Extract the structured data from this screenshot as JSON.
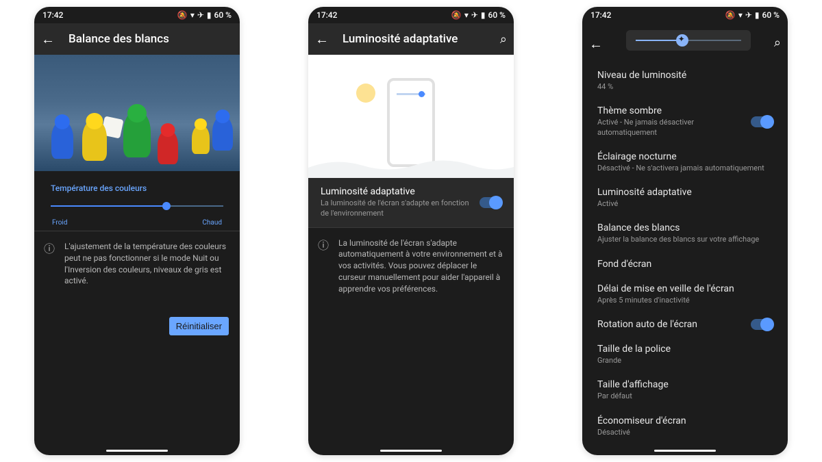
{
  "status": {
    "time": "17:42",
    "battery": "60 %"
  },
  "screen1": {
    "title": "Balance des blancs",
    "section_label": "Température des couleurs",
    "cold": "Froid",
    "hot": "Chaud",
    "slider_pct": 67,
    "info": "L'ajustement de la température des couleurs peut ne pas fonctionner si le mode Nuit ou l'Inversion des couleurs, niveaux de gris est activé.",
    "reset": "Réinitialiser"
  },
  "screen2": {
    "title": "Luminosité adaptative",
    "setting_title": "Luminosité adaptative",
    "setting_sub": "La luminosité de l'écran s'adapte en fonction de l'environnement",
    "info": "La luminosité de l'écran s'adapte automatiquement à votre environnement et à vos activités. Vous pouvez déplacer le curseur manuellement pour aider l'appareil à apprendre vos préférences."
  },
  "screen3": {
    "brightness_pct": 44,
    "items": [
      {
        "title": "Niveau de luminosité",
        "sub": "44 %",
        "toggle": null
      },
      {
        "title": "Thème sombre",
        "sub": "Activé - Ne jamais désactiver automatiquement",
        "toggle": true
      },
      {
        "title": "Éclairage nocturne",
        "sub": "Désactivé - Ne s'activera jamais automatiquement",
        "toggle": null
      },
      {
        "title": "Luminosité adaptative",
        "sub": "Activé",
        "toggle": null
      },
      {
        "title": "Balance des blancs",
        "sub": "Ajuster la balance des blancs sur votre affichage",
        "toggle": null
      },
      {
        "title": "Fond d'écran",
        "sub": "",
        "toggle": null
      },
      {
        "title": "Délai de mise en veille de l'écran",
        "sub": "Après 5 minutes d'inactivité",
        "toggle": null
      },
      {
        "title": "Rotation auto de l'écran",
        "sub": "",
        "toggle": true
      },
      {
        "title": "Taille de la police",
        "sub": "Grande",
        "toggle": null
      },
      {
        "title": "Taille d'affichage",
        "sub": "Par défaut",
        "toggle": null
      },
      {
        "title": "Économiseur d'écran",
        "sub": "Désactivé",
        "toggle": null
      }
    ]
  }
}
